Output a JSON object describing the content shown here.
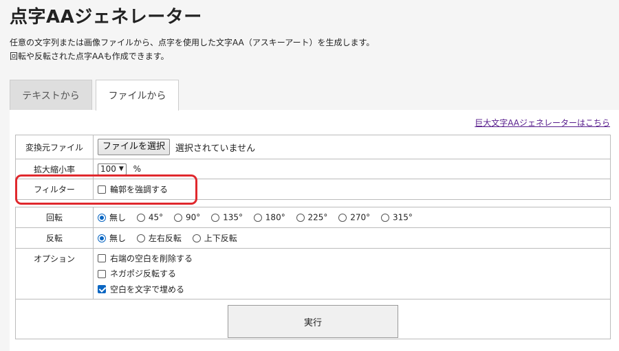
{
  "page": {
    "title": "点字AAジェネレーター",
    "desc_line1": "任意の文字列または画像ファイルから、点字を使用した文字AA（アスキーアート）を生成します。",
    "desc_line2": "回転や反転された点字AAも作成できます。"
  },
  "tabs": [
    {
      "label": "テキストから",
      "active": false
    },
    {
      "label": "ファイルから",
      "active": true
    }
  ],
  "link": {
    "label": "巨大文字AAジェネレーターはこちら"
  },
  "form": {
    "file": {
      "label": "変換元ファイル",
      "button": "ファイルを選択",
      "status": "選択されていません"
    },
    "scale": {
      "label": "拡大縮小率",
      "value": "100",
      "unit": "%"
    },
    "filter": {
      "label": "フィルター",
      "option": "輪郭を強調する",
      "checked": false
    },
    "rotate": {
      "label": "回転",
      "options": [
        "無し",
        "45°",
        "90°",
        "135°",
        "180°",
        "225°",
        "270°",
        "315°"
      ],
      "selected": "無し"
    },
    "flip": {
      "label": "反転",
      "options": [
        "無し",
        "左右反転",
        "上下反転"
      ],
      "selected": "無し"
    },
    "options": {
      "label": "オプション",
      "items": [
        {
          "label": "右端の空白を削除する",
          "checked": false
        },
        {
          "label": "ネガポジ反転する",
          "checked": false
        },
        {
          "label": "空白を文字で埋める",
          "checked": true
        }
      ]
    },
    "run": {
      "label": "実行"
    }
  },
  "colors": {
    "accent": "#0a66c2",
    "highlight": "#e0282d",
    "link": "#551a8b"
  }
}
